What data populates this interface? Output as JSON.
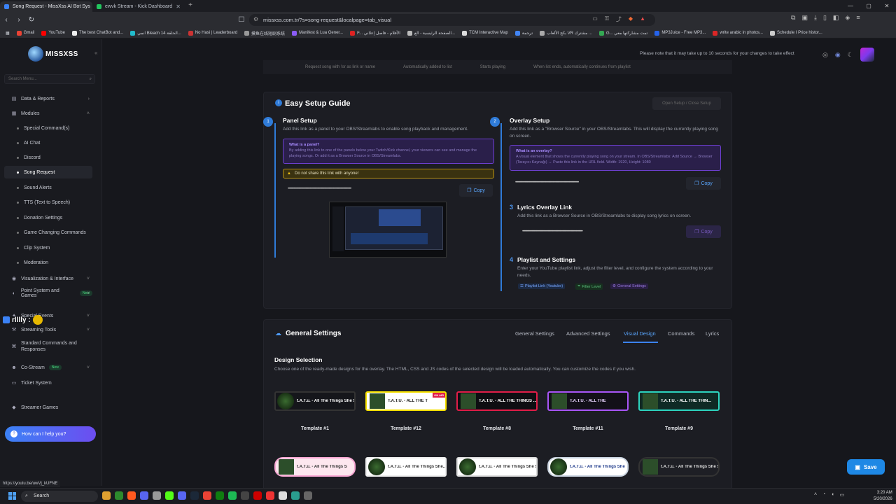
{
  "browser": {
    "tabs": [
      {
        "title": "Song Request - MissXss AI Bot Sys",
        "active": true,
        "favicon_color": "#3b82f6"
      },
      {
        "title": "ewvk Stream - Kick Dashboard",
        "active": false,
        "favicon_color": "#22c55e"
      }
    ],
    "url": "missxss.com.tr/?s=song-request&localpage=tab_visual",
    "bookmarks": [
      {
        "label": "Gmail",
        "color": "#ea4335"
      },
      {
        "label": "YouTube",
        "color": "#ff0000"
      },
      {
        "label": "The best ChatBot and...",
        "color": "#eeeeee"
      },
      {
        "label": "انمي Bleach الحلقة 14...",
        "color": "#22bbcc"
      },
      {
        "label": "No Hasi | Leaderboard",
        "color": "#cc3333"
      },
      {
        "label": "摸鱼在线短剧系统",
        "color": "#999999"
      },
      {
        "label": "Manifest & Lua Gener...",
        "color": "#8b5cf6"
      },
      {
        "label": "F... الأفلام - فاصل إعلاني",
        "color": "#dd2222"
      },
      {
        "label": "الصفحة الرئيسية - الع...",
        "color": "#bbbbbb"
      },
      {
        "label": "TCM Interactive Map",
        "color": "#dddddd"
      },
      {
        "label": "ترجمة",
        "color": "#4285f4"
      },
      {
        "label": "بكج الألعاب VR مشترك ...",
        "color": "#aaaaaa"
      },
      {
        "label": "G... تمت مشاركتها معي",
        "color": "#34a853"
      },
      {
        "label": "MP3Juice - Free MP3...",
        "color": "#2563eb"
      },
      {
        "label": "write arabic in photos...",
        "color": "#dc2626"
      },
      {
        "label": "Schedule I Price histor...",
        "color": "#cccccc"
      }
    ]
  },
  "app": {
    "brand": "MISSXSS",
    "notice": "Please note that it may take up to 10 seconds for your changes to take effect",
    "search_placeholder": "Search Menu...",
    "help_button": "How can I help you?",
    "overlay_text": "rlllly :",
    "save_button": "Save",
    "status_url": "https://youtu.be/uwVj_kUFNE"
  },
  "sidebar": {
    "items": [
      {
        "label": "Data & Reports",
        "icon": "chart-icon",
        "chev": "›",
        "sub": false,
        "active": false
      },
      {
        "label": "Modules",
        "icon": "grid-icon",
        "chev": "˄",
        "sub": false,
        "active": false
      },
      {
        "label": "Special Command(s)",
        "sub": true,
        "active": false
      },
      {
        "label": "AI Chat",
        "sub": true,
        "active": false
      },
      {
        "label": "Discord",
        "sub": true,
        "active": false
      },
      {
        "label": "Song Request",
        "sub": true,
        "active": true
      },
      {
        "label": "Sound Alerts",
        "sub": true,
        "active": false
      },
      {
        "label": "TTS (Text to Speech)",
        "sub": true,
        "active": false
      },
      {
        "label": "Donation Settings",
        "sub": true,
        "active": false
      },
      {
        "label": "Game Changing Commands",
        "sub": true,
        "active": false
      },
      {
        "label": "Clip System",
        "sub": true,
        "active": false
      },
      {
        "label": "Moderation",
        "sub": true,
        "active": false
      },
      {
        "label": "Visualization & Interface",
        "icon": "eye-icon",
        "chev": "˅",
        "sub": false,
        "active": false
      },
      {
        "label": "Point System and Games",
        "icon": "coin-icon",
        "chev": "˅",
        "sub": false,
        "active": false,
        "badge": "New"
      },
      {
        "label": "Special Events",
        "icon": "star-icon",
        "chev": "˅",
        "sub": false,
        "active": false
      },
      {
        "label": "Streaming Tools",
        "icon": "tools-icon",
        "chev": "˅",
        "sub": false,
        "active": false
      },
      {
        "label": "Standard Commands and Responses",
        "icon": "cmd-icon",
        "chev": "",
        "sub": false,
        "active": false
      },
      {
        "label": "Co-Stream",
        "icon": "users-icon",
        "chev": "˅",
        "sub": false,
        "active": false,
        "badge": "New"
      },
      {
        "label": "Ticket System",
        "icon": "ticket-icon",
        "chev": "",
        "sub": false,
        "active": false
      },
      {
        "label": "Streamer Games",
        "icon": "gamepad-icon",
        "chev": "",
        "sub": false,
        "active": false
      }
    ]
  },
  "top_strip": [
    "Request song with !sr as link or name",
    "Automatically added to list",
    "Starts playing",
    "When list ends, automatically continues from playlist"
  ],
  "setup": {
    "title": "Easy Setup Guide",
    "open_close_button": "Open Setup / Close Setup",
    "panel": {
      "num": "1",
      "title": "Panel Setup",
      "desc": "Add this link as a panel to your OBS/Streamlabs to enable song playback and management.",
      "info_title": "What is a panel?",
      "info_text": "By adding this link to one of the panels below your Twitch/Kick channel, your viewers can see and manage the playing songs. Or add it as a Browser Source in OBS/Streamlabs.",
      "warning": "Do not share this link with anyone!",
      "copy": "Copy"
    },
    "overlay": {
      "num": "2",
      "title": "Overlay Setup",
      "desc": "Add this link as a \"Browser Source\" in your OBS/Streamlabs. This will display the currently playing song on screen.",
      "info_title": "What is an overlay?",
      "info_text": "A visual element that shows the currently playing song on your stream. In OBS/Streamlabs: Add Source → Browser (Tarayıcı Kaynağı) → Paste this link in the URL field. Width: 1920, Height: 1080",
      "copy": "Copy"
    },
    "lyrics": {
      "num": "3",
      "title": "Lyrics Overlay Link",
      "desc": "Add this link as a Browser Source in OBS/Streamlabs to display song lyrics on screen.",
      "copy": "Copy"
    },
    "playlist": {
      "num": "4",
      "title": "Playlist and Settings",
      "desc": "Enter your YouTube playlist link, adjust the filter level, and configure the system according to your needs.",
      "chips": [
        "Playlist Link (Youtube)",
        "Filter Level",
        "General Settings"
      ]
    }
  },
  "general": {
    "title": "General Settings",
    "tabs": [
      "General Settings",
      "Advanced Settings",
      "Visual Design",
      "Commands",
      "Lyrics"
    ],
    "active_tab": "Visual Design",
    "design_title": "Design Selection",
    "design_desc": "Choose one of the ready-made designs for the overlay. The HTML, CSS and JS codes of the selected design will be loaded automatically. You can customize the codes if you wish.",
    "templates_row1": [
      {
        "label": "Template #1",
        "song": "t.A.T.u. - All The Things She Said [",
        "style": "dark"
      },
      {
        "label": "Template #12",
        "song": "T.A.T.U. - ALL THE T",
        "style": "yellow",
        "badge": "ON AIR"
      },
      {
        "label": "Template #8",
        "song": "T.A.T.U. - ALL THE THINGS ...",
        "style": "pink"
      },
      {
        "label": "Template #11",
        "song": "T.A.T.U. - ALL THE",
        "style": "purple"
      },
      {
        "label": "Template #9",
        "song": "T.A.T.U. - ALL THE THIN...",
        "style": "teal"
      }
    ],
    "templates_row2": [
      {
        "song": "t.A.T.u. - All The Things S",
        "style": "lightpink"
      },
      {
        "song": "t.A.T.u. - All The Things She...",
        "style": "bunny"
      },
      {
        "song": "t.A.T.u. - All The Things She Said [...",
        "style": "white"
      },
      {
        "song": "t.A.T.u. - All The Things She",
        "style": "whiteoval"
      },
      {
        "song": "t.A.T.u. - All The Things She Said [...",
        "style": "darkpill"
      }
    ]
  },
  "taskbar": {
    "search": "Search",
    "time": "3:20 AM",
    "date": "5/20/2026"
  }
}
